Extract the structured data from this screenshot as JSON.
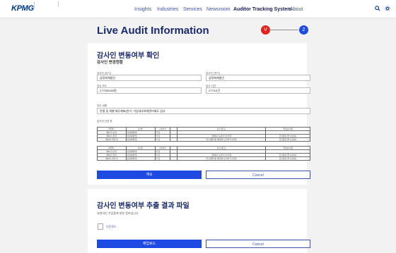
{
  "header": {
    "logo": "KPMG",
    "nav": [
      "Insights",
      "Industries",
      "Services",
      "Newsroom",
      "Auditor Tracking System",
      "About"
    ],
    "active_nav_index": 4,
    "icons": [
      "search-icon",
      "settings-icon"
    ]
  },
  "page": {
    "title": "Live Audit Information",
    "steps": [
      "V",
      "2"
    ],
    "step_colors": [
      "#e3211e",
      "#1e49e2"
    ]
  },
  "confirm": {
    "title": "감사인 변동여부 확인",
    "subtitle": "감사인 변경현황",
    "fields": [
      {
        "label": "감사인 (당기)",
        "value": "삼정회계법인"
      },
      {
        "label": "감사인 (전기)",
        "value": "삼정회계법인"
      },
      {
        "label": "감사 보수",
        "value": "277000000원"
      },
      {
        "label": "감사 시간",
        "value": "2774시간"
      },
      {
        "label": "감사 내용",
        "value": "연결 및 개별 재무제표(연기, 기업내부회계관리제도 검사"
      }
    ],
    "table_label": "감사인 관련 표",
    "table1": {
      "headers": [
        "사업연도",
        "감사인",
        "감사의견",
        "",
        "강조사항 등",
        "핵심감사사항"
      ],
      "rows": [
        [
          "제51기 (당기)",
          "삼정회계법인",
          "적 정",
          "",
          "-",
          "-"
        ],
        [
          "제50기 (전기)",
          "삼정회계법인",
          "적 정",
          "",
          "계열회사 등과의 특수관계",
          "현금창출단위 손상검사"
        ],
        [
          "제49기 (전전기)",
          "삼정회계법인",
          "적 정",
          "",
          "연구개발비용 계열회사 등과의 특수관계",
          "현금창출단위 손상검사"
        ]
      ]
    },
    "table2": {
      "headers": [
        "사업연도",
        "감사인",
        "감사의견",
        "",
        "강조사항 등",
        "핵심감사사항"
      ],
      "rows": [
        [
          "제51기 (당기)",
          "삼정회계법인",
          "적 정",
          "",
          "-",
          "-"
        ],
        [
          "제50기 (전기)",
          "삼정회계법인",
          "적 정",
          "",
          "계열회사 등과의 특수관계",
          "현금창출단위 손상검사"
        ],
        [
          "제49기 (전전기)",
          "삼정회계법인",
          "적 정",
          "",
          "연구개발비용 계열회사 등과의 특수관계",
          "현금창출단위 손상검사"
        ]
      ]
    },
    "primary_button": "계속",
    "cancel_button": "Cancel"
  },
  "result": {
    "title": "감사인 변동여부 추출 결과 파일",
    "description": "요청하신 기업들에 대한 정보입니다.",
    "file_label": "다운로드",
    "primary_button": "재업로드",
    "cancel_button": "Cancel"
  }
}
